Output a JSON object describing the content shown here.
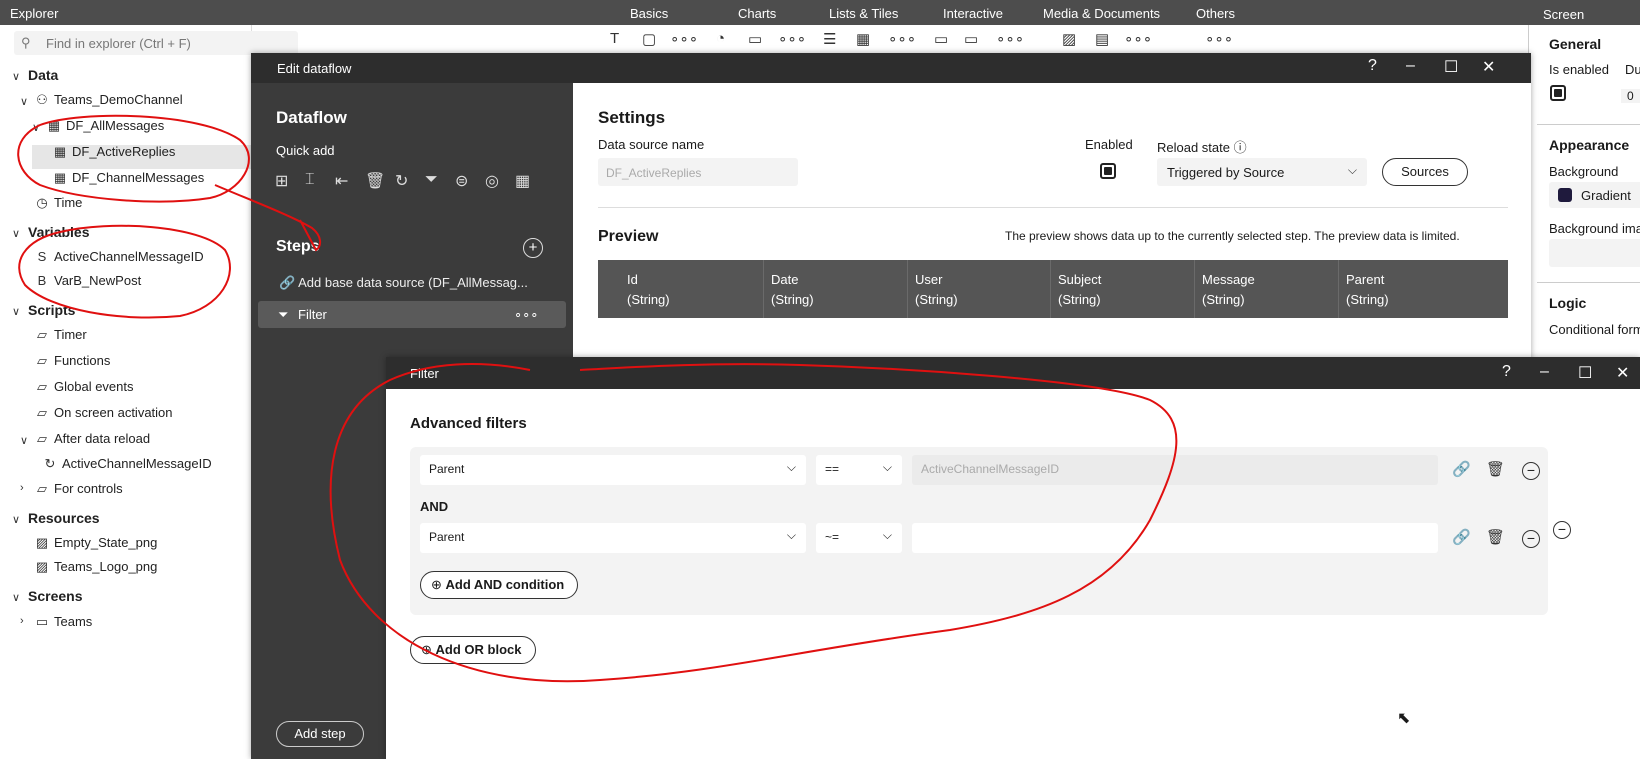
{
  "topbar": {
    "explorer_label": "Explorer",
    "screen_label": "Screen",
    "tabs": [
      "Basics",
      "Charts",
      "Lists & Tiles",
      "Interactive",
      "Media & Documents",
      "Others"
    ]
  },
  "explorer": {
    "search_placeholder": "Find in explorer (Ctrl + F)",
    "data": "Data",
    "teams": "Teams_DemoChannel",
    "df_all": "DF_AllMessages",
    "df_active": "DF_ActiveReplies",
    "df_channel": "DF_ChannelMessages",
    "time": "Time",
    "variables": "Variables",
    "var1": "ActiveChannelMessageID",
    "var2": "VarB_NewPost",
    "scripts": "Scripts",
    "timer": "Timer",
    "functions": "Functions",
    "global_events": "Global events",
    "on_screen": "On screen activation",
    "after_reload": "After data reload",
    "active_msg": "ActiveChannelMessageID",
    "for_controls": "For controls",
    "resources": "Resources",
    "res1": "Empty_State_png",
    "res2": "Teams_Logo_png",
    "screens": "Screens",
    "screen1": "Teams"
  },
  "right_panel": {
    "general": "General",
    "is_enabled": "Is enabled",
    "du": "Du",
    "zero": "0",
    "appearance": "Appearance",
    "background": "Background",
    "gradient": "Gradient",
    "gradient_color": "#1f1a3d",
    "bg_image": "Background ima",
    "logic": "Logic",
    "conditional": "Conditional form"
  },
  "dataflow": {
    "title": "Edit dataflow",
    "heading": "Dataflow",
    "quick_add": "Quick add",
    "steps": "Steps",
    "step_base": "Add base data source (DF_AllMessag...",
    "step_filter": "Filter",
    "add_step": "Add step",
    "settings": "Settings",
    "ds_name_label": "Data source name",
    "ds_name_value": "DF_ActiveReplies",
    "enabled_label": "Enabled",
    "reload_label": "Reload state",
    "reload_value": "Triggered by Source",
    "sources": "Sources",
    "preview": "Preview",
    "preview_note": "The preview shows data up to the currently selected step. The preview data is limited.",
    "columns": [
      {
        "name": "Id",
        "type": "(String)"
      },
      {
        "name": "Date",
        "type": "(String)"
      },
      {
        "name": "User",
        "type": "(String)"
      },
      {
        "name": "Subject",
        "type": "(String)"
      },
      {
        "name": "Message",
        "type": "(String)"
      },
      {
        "name": "Parent",
        "type": "(String)"
      }
    ]
  },
  "filter": {
    "title": "Filter",
    "heading": "Advanced filters",
    "row1": {
      "field": "Parent",
      "op": "==",
      "value_placeholder": "ActiveChannelMessageID"
    },
    "and": "AND",
    "row2": {
      "field": "Parent",
      "op": "~=",
      "value": ""
    },
    "add_and": "Add AND condition",
    "add_or": "Add OR block"
  }
}
